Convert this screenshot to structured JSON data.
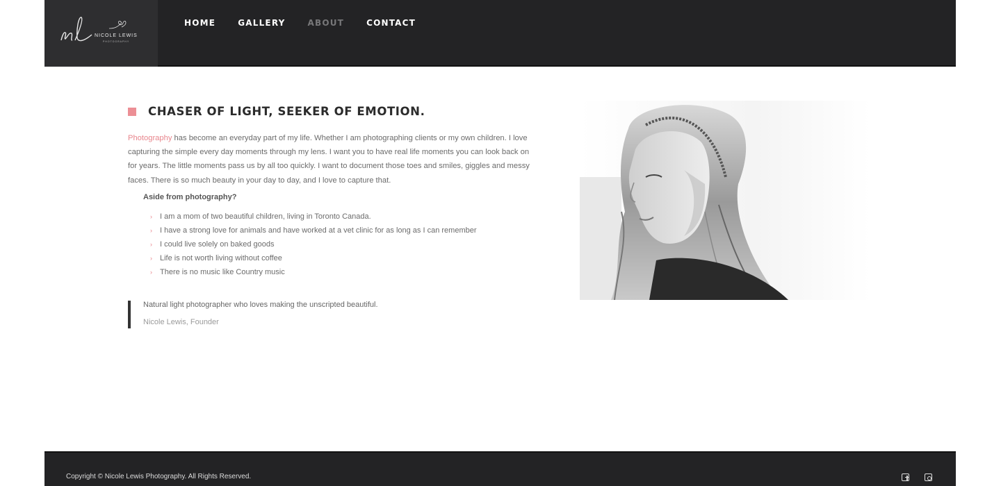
{
  "brand": {
    "name": "NICOLE LEWIS",
    "sub": "PHOTOGRAPHY",
    "accent_color": "#ec8f95",
    "header_color": "#232325"
  },
  "nav": {
    "items": [
      {
        "label": "HOME",
        "active": false
      },
      {
        "label": "GALLERY",
        "active": false
      },
      {
        "label": "ABOUT",
        "active": true
      },
      {
        "label": "CONTACT",
        "active": false
      }
    ]
  },
  "about": {
    "title": "CHASER OF LIGHT, SEEKER OF EMOTION.",
    "intro_link": "Photography",
    "intro_text": " has become an everyday part of my life. Whether I am photographing clients or my own children. I love capturing the simple every day moments through my lens. I want you to have real life moments you can look back on for years. The little moments pass us by all too quickly. I want to document those toes and smiles, giggles and messy faces. There is so much beauty in your day to day, and I love to capture that.",
    "aside_heading": "Aside from photography?",
    "bullets": [
      "I am a mom of two beautiful children, living in Toronto Canada.",
      "I have a strong love for animals and have worked at a vet clinic for as long as I can remember",
      "I could live solely on baked goods",
      "Life is not worth living without coffee",
      "There is no music like Country music"
    ],
    "quote": "Natural light photographer who loves making the unscripted beautiful.",
    "quote_cite": "Nicole Lewis, Founder"
  },
  "footer": {
    "copyright": "Copyright © Nicole Lewis Photography. All Rights Reserved.",
    "social": [
      "facebook-icon",
      "instagram-icon"
    ]
  }
}
